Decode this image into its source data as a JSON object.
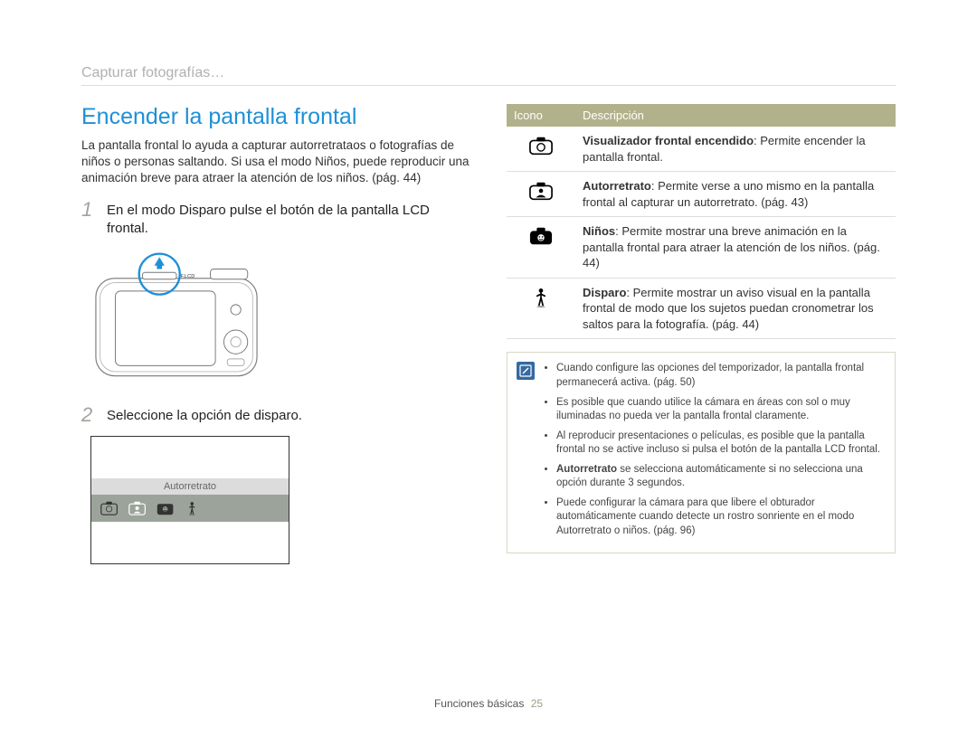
{
  "breadcrumb": "Capturar fotografías…",
  "title": "Encender la pantalla frontal",
  "intro": "La pantalla frontal lo ayuda a capturar autorretrataos o fotografías de niños o personas saltando. Si usa el modo Niños, puede reproducir una animación breve para atraer la atención de los niños. (pág. 44)",
  "steps": [
    {
      "num": "1",
      "text": "En el modo Disparo pulse el botón de la pantalla LCD frontal."
    },
    {
      "num": "2",
      "text": "Seleccione la opción de disparo."
    }
  ],
  "camera_button_label": "F.LCD",
  "shot_option_label": "Autorretrato",
  "table": {
    "headers": {
      "icon": "Icono",
      "desc": "Descripción"
    },
    "rows": [
      {
        "title": "Visualizador frontal encendido",
        "body": ": Permite encender la pantalla frontal."
      },
      {
        "title": "Autorretrato",
        "body": ": Permite verse a uno mismo en la pantalla frontal al capturar un autorretrato. (pág. 43)"
      },
      {
        "title": "Niños",
        "body": ": Permite mostrar una breve animación en la pantalla frontal para atraer la atención de los niños. (pág. 44)"
      },
      {
        "title": "Disparo",
        "body": ": Permite mostrar un aviso visual en la pantalla frontal de modo que los sujetos puedan cronometrar los saltos para la fotografía. (pág. 44)"
      }
    ]
  },
  "notes": [
    "Cuando configure las opciones del temporizador, la pantalla frontal permanecerá activa. (pág. 50)",
    "Es posible que cuando utilice la cámara en áreas con sol o muy iluminadas no pueda ver la pantalla frontal claramente.",
    "Al reproducir presentaciones o películas, es posible que la pantalla frontal no se active incluso si pulsa el botón de la pantalla LCD frontal.",
    "<b>Autorretrato</b> se selecciona automáticamente si no selecciona una opción durante 3 segundos.",
    "Puede configurar la cámara para que libere el obturador automáticamente cuando detecte un rostro sonriente en el modo Autorretrato o niños. (pág. 96)"
  ],
  "footer": {
    "section": "Funciones básicas",
    "page": "25"
  }
}
